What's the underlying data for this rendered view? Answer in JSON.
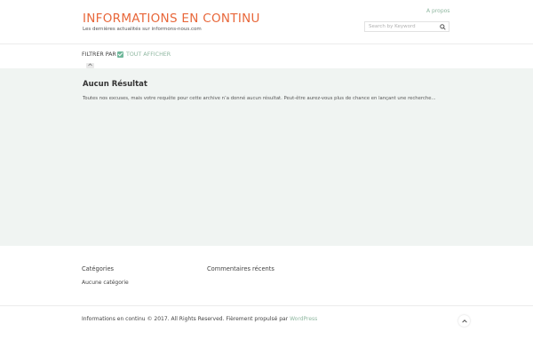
{
  "header": {
    "site_title": "INFORMATIONS EN CONTINU",
    "tagline": "Les dernières actualités sur informons-nous.com",
    "nav_link": "A propos",
    "search_placeholder": "Search by Keyword"
  },
  "filter": {
    "label": "FILTRER PAR",
    "all_label": "TOUT AFFICHER"
  },
  "main": {
    "title": "Aucun Résultat",
    "message": "Toutes nos excuses, mais votre requête pour cette archive n’a donné aucun résultat. Peut-être aurez-vous plus de chance en lançant une recherche..."
  },
  "widgets": {
    "categories_title": "Catégories",
    "categories_item": "Aucune catégorie",
    "comments_title": "Commentaires récents"
  },
  "footer": {
    "copyright": "Informations en continu © 2017. All Rights Reserved. Fièrement propulsé par",
    "wp_link": "WordPress"
  },
  "colors": {
    "accent": "#e8673a",
    "link": "#8fb7a0",
    "main_bg": "#f0f4f2"
  },
  "icons": [
    "search-icon",
    "check-icon",
    "chevron-up-icon"
  ]
}
